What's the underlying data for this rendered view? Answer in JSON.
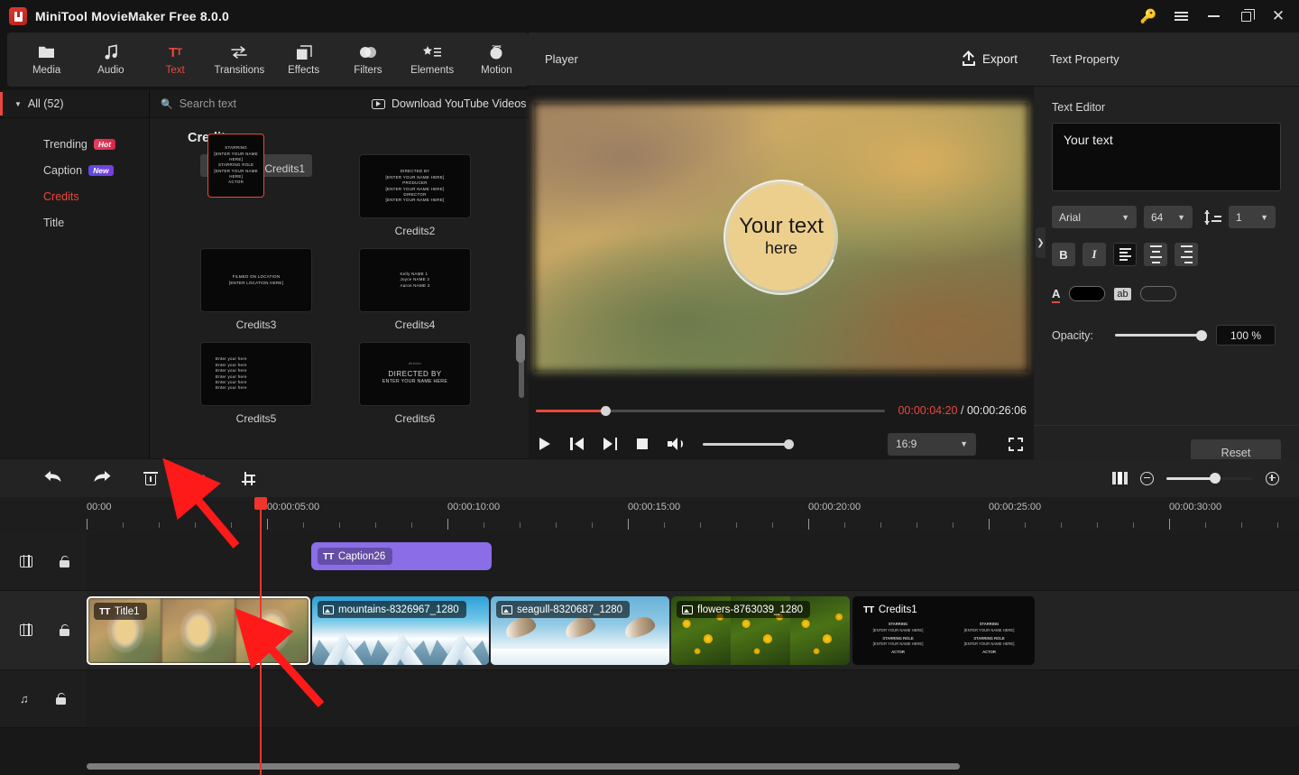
{
  "window": {
    "title": "MiniTool MovieMaker Free 8.0.0",
    "controls": {
      "key": "key-icon",
      "menu": "menu-icon",
      "minimize": "minimize",
      "maximize": "maximize",
      "close": "close"
    }
  },
  "ribbon": {
    "tabs": [
      {
        "label": "Media",
        "icon": "folder-icon",
        "active": false
      },
      {
        "label": "Audio",
        "icon": "music-note-icon",
        "active": false
      },
      {
        "label": "Text",
        "icon": "text-icon",
        "active": true
      },
      {
        "label": "Transitions",
        "icon": "transitions-icon",
        "active": false
      },
      {
        "label": "Effects",
        "icon": "effects-icon",
        "active": false
      },
      {
        "label": "Filters",
        "icon": "filters-icon",
        "active": false
      },
      {
        "label": "Elements",
        "icon": "elements-icon",
        "active": false
      },
      {
        "label": "Motion",
        "icon": "motion-icon",
        "active": false
      }
    ]
  },
  "categories": {
    "header": "All (52)",
    "items": [
      {
        "label": "Trending",
        "badge": "Hot",
        "badge_kind": "hot",
        "active": false
      },
      {
        "label": "Caption",
        "badge": "New",
        "badge_kind": "new",
        "active": false
      },
      {
        "label": "Credits",
        "badge": "",
        "badge_kind": "",
        "active": true
      },
      {
        "label": "Title",
        "badge": "",
        "badge_kind": "",
        "active": false
      }
    ]
  },
  "library": {
    "search_placeholder": "Search text",
    "download_label": "Download YouTube Videos",
    "section_title": "Credits",
    "items": [
      {
        "name": "Credits1",
        "selected": true,
        "lines": [
          "STARRING",
          "[ENTER YOUR NAME HERE]",
          "STARRING ROLE",
          "[ENTER YOUR NAME HERE]",
          "ACTOR"
        ]
      },
      {
        "name": "Credits2",
        "selected": false,
        "lines": [
          "DIRECTED BY",
          "[ENTER YOUR NAME HERE]",
          "PRODUCER",
          "[ENTER YOUR NAME HERE]",
          "DIRECTOR",
          "[ENTER YOUR NAME HERE]"
        ]
      },
      {
        "name": "Credits3",
        "selected": false,
        "lines": [
          "FILMED ON LOCATION",
          "[ENTER LOCATION HERE]"
        ]
      },
      {
        "name": "Credits4",
        "selected": false,
        "lines": [
          "Kelly NAME 1",
          "Joyce NAME 2",
          "Aaron NAME 3"
        ]
      },
      {
        "name": "Credits5",
        "selected": false,
        "lines": [
          "Enter your here",
          "Enter your here",
          "Enter your here",
          "Enter your here",
          "Enter your here",
          "Enter your here"
        ]
      },
      {
        "name": "Credits6",
        "selected": false,
        "lines": [
          "director",
          "DIRECTED BY",
          "ENTER YOUR NAME HERE"
        ]
      }
    ]
  },
  "player": {
    "label": "Player",
    "export_label": "Export",
    "preview_text_line1": "Your text",
    "preview_text_line2": "here",
    "current_time": "00:00:04:20",
    "separator": "/",
    "total_time": "00:00:26:06",
    "progress_percent": 20,
    "aspect_ratio": "16:9",
    "volume_percent": 100,
    "controls": [
      "play",
      "previous-frame",
      "next-frame",
      "stop",
      "volume",
      "aspect-ratio",
      "fullscreen"
    ]
  },
  "text_property": {
    "panel_title": "Text Property",
    "editor_label": "Text Editor",
    "editor_value": "Your text",
    "font_family": "Arial",
    "font_size": "64",
    "line_spacing": "1",
    "style_buttons": [
      {
        "name": "bold",
        "label": "B",
        "active": false
      },
      {
        "name": "italic",
        "label": "I",
        "active": false
      },
      {
        "name": "align-left",
        "label": "",
        "active": true
      },
      {
        "name": "align-center",
        "label": "",
        "active": false
      },
      {
        "name": "align-right",
        "label": "",
        "active": false
      }
    ],
    "font_color_label": "A",
    "font_color": "#000000",
    "outline_label": "ab",
    "outline_color": "transparent",
    "opacity_label": "Opacity:",
    "opacity_value": "100 %",
    "opacity_percent": 100,
    "reset_label": "Reset"
  },
  "timeline_toolbar": {
    "buttons": [
      {
        "name": "undo",
        "icon": "undo-arrow-icon"
      },
      {
        "name": "redo",
        "icon": "redo-arrow-icon"
      },
      {
        "name": "delete",
        "icon": "trash-icon"
      },
      {
        "name": "split",
        "icon": "scissors-icon"
      },
      {
        "name": "crop",
        "icon": "crop-icon"
      }
    ],
    "right_tools": [
      {
        "name": "split-view",
        "icon": "split-view-icon"
      },
      {
        "name": "zoom-out",
        "icon": "minus-circle-icon"
      },
      {
        "name": "zoom-slider",
        "icon": "slider",
        "percent": 56
      },
      {
        "name": "zoom-in",
        "icon": "plus-circle-icon"
      }
    ]
  },
  "timeline": {
    "zoom_icons": [
      {
        "name": "zoom-in-track",
        "icon": "plus-box-icon"
      },
      {
        "name": "zoom-out-track",
        "icon": "minus-box-icon"
      }
    ],
    "ruler_labels": [
      "00:00",
      "00:00:05:00",
      "00:00:10:00",
      "00:00:15:00",
      "00:00:20:00",
      "00:00:25:00",
      "00:00:30:00"
    ],
    "playhead_position": "00:00:04:20",
    "tracks": [
      {
        "name": "text-track",
        "icon": "film-icon",
        "lock": "lock-icon"
      },
      {
        "name": "video-track",
        "icon": "film-icon",
        "lock": "lock-icon"
      },
      {
        "name": "audio-track",
        "icon": "music-note-icon",
        "lock": "lock-icon"
      }
    ],
    "text_clips": [
      {
        "label": "Caption26",
        "icon": "text-icon",
        "color": "#8b6de8"
      }
    ],
    "video_clips": [
      {
        "label": "Title1",
        "icon": "text-icon",
        "kind": "title",
        "selected": true
      },
      {
        "label": "mountains-8326967_1280",
        "icon": "photo-icon",
        "kind": "mountains",
        "selected": false
      },
      {
        "label": "seagull-8320687_1280",
        "icon": "photo-icon",
        "kind": "seagull",
        "selected": false
      },
      {
        "label": "flowers-8763039_1280",
        "icon": "photo-icon",
        "kind": "flowers",
        "selected": false
      },
      {
        "label": "Credits1",
        "icon": "text-icon",
        "kind": "credits",
        "selected": false
      }
    ],
    "credits_clip_lines": [
      "STARRING",
      "[ENTER YOUR NAME HERE]",
      "STARRING ROLE",
      "[ENTER YOUR NAME HERE]",
      "ACTOR"
    ],
    "cut_marker_icon": "scissors-icon"
  },
  "colors": {
    "accent_red": "#e8493c",
    "caption_purple": "#8b6de8",
    "playhead_red": "#f0352a",
    "annotation_red": "#ff1a1a"
  }
}
